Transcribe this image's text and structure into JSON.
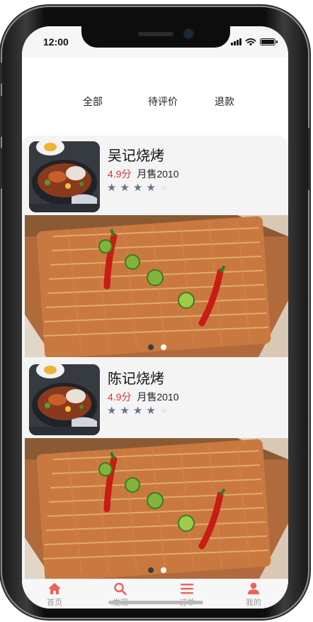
{
  "status_bar": {
    "time": "12:00"
  },
  "tabs": [
    {
      "label": "全部"
    },
    {
      "label": "待评价"
    },
    {
      "label": "退款"
    }
  ],
  "shops": [
    {
      "name": "吴记烧烤",
      "score": "4.9分",
      "sales": "月售2010",
      "stars": 4,
      "max_stars": 5
    },
    {
      "name": "陈记烧烤",
      "score": "4.9分",
      "sales": "月售2010",
      "stars": 4,
      "max_stars": 5
    }
  ],
  "banner": {
    "slides": 2,
    "active_slide": 1
  },
  "tabbar": [
    {
      "label": "首页",
      "icon": "home-icon",
      "color": "#f0605a"
    },
    {
      "label": "发现",
      "icon": "search-icon",
      "color": "#f0605a"
    },
    {
      "label": "订单",
      "icon": "list-icon",
      "color": "#f0605a"
    },
    {
      "label": "我的",
      "icon": "user-icon",
      "color": "#f0605a"
    }
  ],
  "colors": {
    "accent": "#f0605a",
    "score": "#e0332b",
    "star": "#64748b"
  }
}
